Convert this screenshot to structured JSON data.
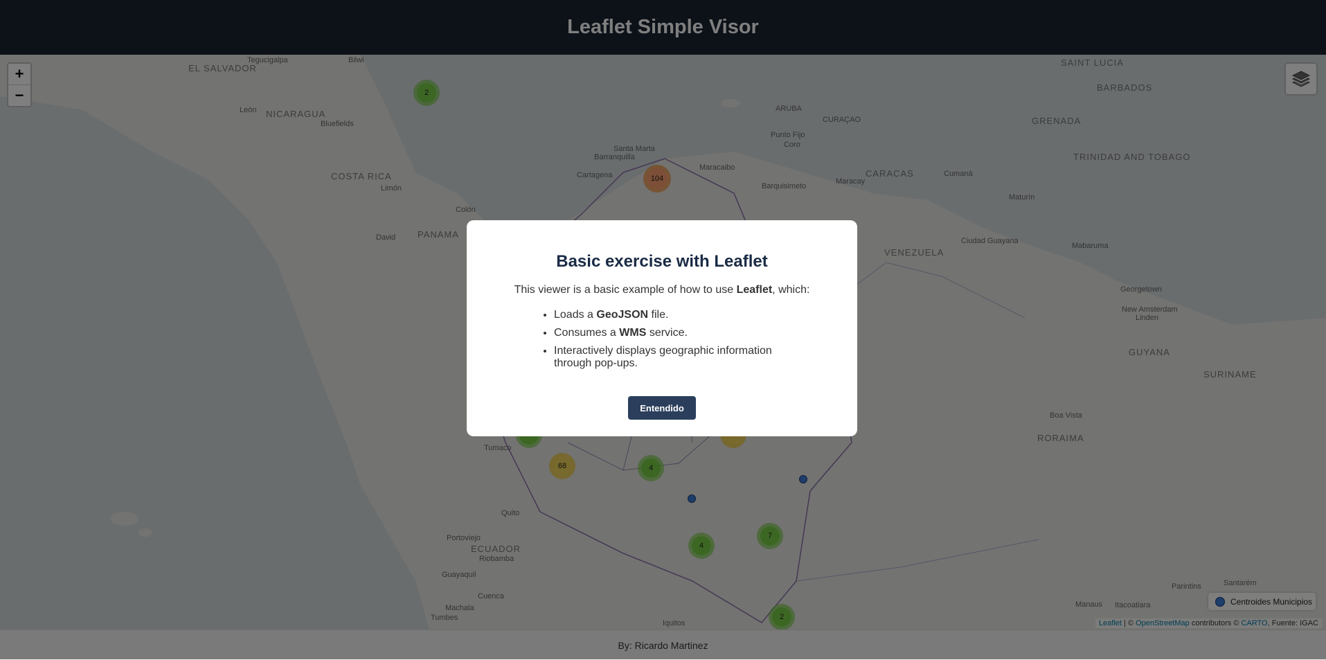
{
  "header": {
    "title": "Leaflet Simple Visor"
  },
  "map": {
    "zoom_in": "+",
    "zoom_out": "−",
    "labels": [
      {
        "text": "EL SALVADOR"
      },
      {
        "text": "Tegucigalpa"
      },
      {
        "text": "Bilwi"
      },
      {
        "text": "NICARAGUA"
      },
      {
        "text": "León"
      },
      {
        "text": "Bluefields"
      },
      {
        "text": "COSTA RICA"
      },
      {
        "text": "Limón"
      },
      {
        "text": "PANAMA"
      },
      {
        "text": "David"
      },
      {
        "text": "Colón"
      },
      {
        "text": "Santa Marta"
      },
      {
        "text": "Barranquilla"
      },
      {
        "text": "Cartagena"
      },
      {
        "text": "Maracaibo"
      },
      {
        "text": "ARUBA"
      },
      {
        "text": "CURAÇAO"
      },
      {
        "text": "Punto Fijo"
      },
      {
        "text": "Coro"
      },
      {
        "text": "Barquisimeto"
      },
      {
        "text": "Maracay"
      },
      {
        "text": "CARACAS"
      },
      {
        "text": "Cumaná"
      },
      {
        "text": "Maturín"
      },
      {
        "text": "VENEZUELA"
      },
      {
        "text": "Ciudad Guayana"
      },
      {
        "text": "Mabaruma"
      },
      {
        "text": "GRENADA"
      },
      {
        "text": "TRINIDAD AND TOBAGO"
      },
      {
        "text": "BARBADOS"
      },
      {
        "text": "SAINT LUCIA"
      },
      {
        "text": "Georgetown"
      },
      {
        "text": "New Amsterdam"
      },
      {
        "text": "Linden"
      },
      {
        "text": "GUYANA"
      },
      {
        "text": "SURINAME"
      },
      {
        "text": "Boa Vista"
      },
      {
        "text": "RORAIMA"
      },
      {
        "text": "Tumaco"
      },
      {
        "text": "Quito"
      },
      {
        "text": "Portoviejo"
      },
      {
        "text": "ECUADOR"
      },
      {
        "text": "Riobamba"
      },
      {
        "text": "Guayaquil"
      },
      {
        "text": "Cuenca"
      },
      {
        "text": "Machala"
      },
      {
        "text": "Tumbes"
      },
      {
        "text": "Iquitos"
      },
      {
        "text": "Manaus"
      },
      {
        "text": "Itacoatiara"
      },
      {
        "text": "Parintins"
      },
      {
        "text": "Santarém"
      }
    ],
    "clusters": [
      "2",
      "104",
      "68",
      "4",
      "4",
      "7",
      "2"
    ],
    "legend": {
      "label": "Centroides Municipios",
      "color": "#3a7bd5"
    },
    "attribution": {
      "leaflet": "Leaflet",
      "sep": " | © ",
      "osm": "OpenStreetMap",
      "mid": " contributors © ",
      "carto": "CARTO",
      "source": ", Fuente: IGAC"
    }
  },
  "modal": {
    "title": "Basic exercise with Leaflet",
    "intro_pre": "This viewer is a basic example of how to use ",
    "intro_bold": "Leaflet",
    "intro_post": ", which:",
    "items": [
      {
        "pre": "Loads a ",
        "bold": "GeoJSON",
        "post": " file."
      },
      {
        "pre": "Consumes a ",
        "bold": "WMS",
        "post": " service."
      },
      {
        "pre": "Interactively displays geographic information through pop-ups.",
        "bold": "",
        "post": ""
      }
    ],
    "button": "Entendido"
  },
  "footer": {
    "credit": "By: Ricardo Martinez"
  }
}
